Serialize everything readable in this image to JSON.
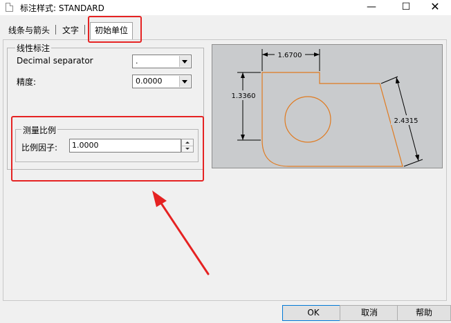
{
  "window": {
    "title": "标注样式: STANDARD",
    "minimize_glyph": "—",
    "maximize_glyph": "☐",
    "close_glyph": "✕"
  },
  "tabs": [
    {
      "label": "线条与箭头"
    },
    {
      "label": "文字"
    },
    {
      "label": "初始单位",
      "active": true
    }
  ],
  "linear": {
    "group_label": "线性标注",
    "decimal_label": "Decimal separator",
    "decimal_value": ".",
    "precision_label": "精度:",
    "precision_value": "0.0000"
  },
  "scale": {
    "group_label": "测量比例",
    "factor_label": "比例因子:",
    "factor_value": "1.0000"
  },
  "preview": {
    "dim_top": "1.6700",
    "dim_left": "1.3360",
    "dim_right": "2.4315",
    "shape_color": "#e07a1f",
    "background": "#c9cbcd"
  },
  "buttons": {
    "ok": "OK",
    "cancel": "取消",
    "help": "帮助"
  },
  "annotation_color": "#e52222"
}
